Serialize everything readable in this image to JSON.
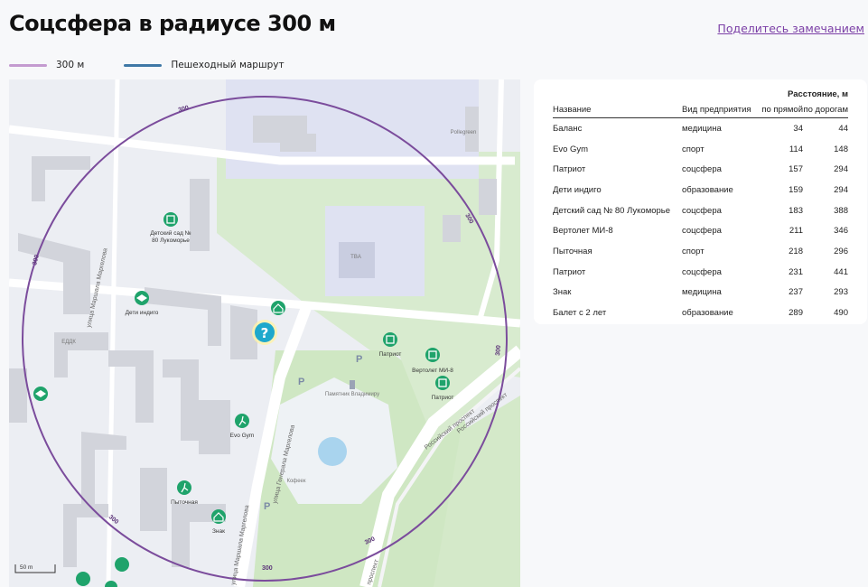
{
  "header": {
    "title": "Соцсфера в радиусе 300 м",
    "share_link": "Поделитесь замечанием"
  },
  "legend": [
    {
      "label": "300 м",
      "color": "#c49bd0"
    },
    {
      "label": "Пешеходный маршрут",
      "color": "#3f78a6"
    }
  ],
  "map": {
    "radius_label": "300",
    "scale_label": "50 m",
    "colors": {
      "circle": "#7b4c9c",
      "poi": "#1fa36b",
      "target": "#1ea8cc"
    },
    "street_labels": [
      "улица Генерала Маргелова",
      "Российский проспект",
      "улица Маршала Маргелова",
      "проспект"
    ],
    "poi_labels": [
      "Детский сад №\n80 Лукоморье",
      "Дети индиго",
      "Патриот",
      "Вертолет МИ-8",
      "Патриот",
      "Evo Gym",
      "Пыточная",
      "Знак",
      "Памятник Владимиру",
      "Кофеек",
      "Pollegreen",
      "ЕДДК",
      "TBA"
    ]
  },
  "table": {
    "group_header": "Расстояние, м",
    "columns": [
      "Название",
      "Вид предприятия",
      "по прямой",
      "по дорогам"
    ],
    "rows": [
      [
        "Баланс",
        "медицина",
        "34",
        "44"
      ],
      [
        "Evo Gym",
        "спорт",
        "114",
        "148"
      ],
      [
        "Патриот",
        "соцсфера",
        "157",
        "294"
      ],
      [
        "Дети индиго",
        "образование",
        "159",
        "294"
      ],
      [
        "Детский сад № 80 Лукоморье",
        "соцсфера",
        "183",
        "388"
      ],
      [
        "Вертолет МИ-8",
        "соцсфера",
        "211",
        "346"
      ],
      [
        "Пыточная",
        "спорт",
        "218",
        "296"
      ],
      [
        "Патриот",
        "соцсфера",
        "231",
        "441"
      ],
      [
        "Знак",
        "медицина",
        "237",
        "293"
      ],
      [
        "Балет с 2 лет",
        "образование",
        "289",
        "490"
      ]
    ]
  }
}
